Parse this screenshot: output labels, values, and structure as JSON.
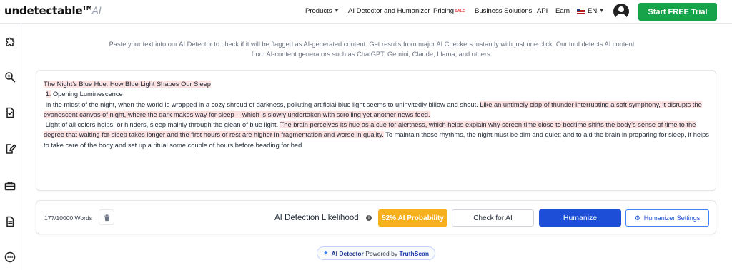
{
  "header": {
    "logo": {
      "text": "undetectable",
      "tm": "TM",
      "ai": "AI"
    },
    "nav": [
      {
        "label": "Products",
        "has_chevron": true
      },
      {
        "label": "AI Detector and Humanizer"
      },
      {
        "label": "Pricing",
        "badge": "SALE"
      },
      {
        "label": "Business Solutions"
      },
      {
        "label": "API"
      },
      {
        "label": "Earn"
      }
    ],
    "language": "EN",
    "cta_label": "Start FREE Trial"
  },
  "sidebar": {
    "icons": [
      "puzzle-icon",
      "search-ai-icon",
      "document-check-icon",
      "edit-document-icon",
      "briefcase-icon",
      "document-icon",
      "chat-icon"
    ]
  },
  "intro_text": "Paste your text into our AI Detector to check if it will be flagged as AI-generated content. Get results from major AI Checkers instantly with just one click. Our tool detects AI content from AI-content generators such as ChatGPT, Gemini, Claude, Llama, and others.",
  "editor": {
    "title": "The Night’s Blue Hue: How Blue Light Shapes Our Sleep",
    "heading_number": "1.",
    "heading_text": "Opening Luminescence",
    "p1_plain": "In the midst of the night, when the world is wrapped in a cozy shroud of darkness, polluting artificial blue light seems to uninvitedly billow and shout. ",
    "p1_hl": "Like an untimely clap of thunder interrupting a soft symphony, it disrupts the evanescent canvas of night, where the dark makes way for sleep -- which is slowly undertaken with scrolling yet another news feed.",
    "p2_plain_a": "Light of all colors helps, or hinders, sleep mainly through the glean of blue light. ",
    "p2_hl": "The brain perceives its hue as a cue for alertness, which helps explain why screen time close to bedtime shifts the body’s sense of time to the degree that waiting for sleep takes longer and the first hours of rest are higher in fragmentation and worse in quality.",
    "p2_plain_b": " To maintain these rhythms, the night must be dim and quiet; and to aid the brain in preparing for sleep, it helps to take care of the body and set up a ritual some couple of hours before heading for bed."
  },
  "toolbar": {
    "word_count": "177/10000 Words",
    "likelihood_label": "AI Detection Likelihood",
    "probability_label": "52% AI Probability",
    "probability_value": 52,
    "check_label": "Check for AI",
    "humanize_label": "Humanize",
    "settings_label": "Humanizer Settings"
  },
  "powered": {
    "prefix": "AI Detector",
    "middle": "Powered by",
    "brand": "TruthScan"
  },
  "colors": {
    "brand_green": "#16a34a",
    "humanize_blue": "#1d4ed8",
    "probability_amber": "#f6b01e",
    "highlight_pink": "#fde2e2"
  }
}
